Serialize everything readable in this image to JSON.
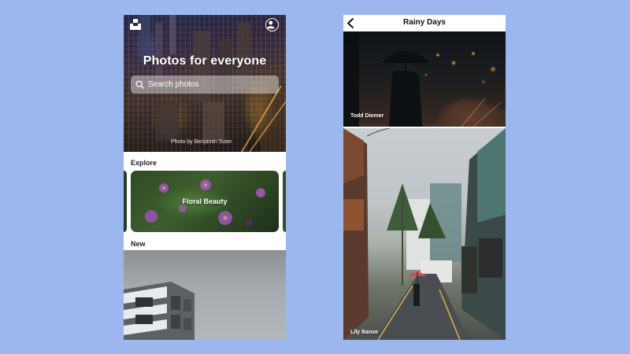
{
  "home_screen": {
    "hero": {
      "title": "Photos for everyone",
      "search_placeholder": "Search photos",
      "credit": "Photo by Benjamin Suter"
    },
    "icons": {
      "logo": "unsplash-logo-icon",
      "avatar": "user-avatar-icon",
      "search": "search-icon"
    },
    "sections": {
      "explore_label": "Explore",
      "new_label": "New"
    },
    "explore_card": {
      "title": "Floral Beauty"
    }
  },
  "collection_screen": {
    "nav": {
      "title": "Rainy Days",
      "back_icon": "chevron-left-icon"
    },
    "photos": [
      {
        "credit": "Todd Diemer"
      },
      {
        "credit": "Lily Banse"
      }
    ]
  },
  "colors": {
    "background": "#9BB7EE",
    "screen": "#FFFFFF",
    "text_dark": "#222222",
    "umbrella_red": "#E0454F"
  }
}
